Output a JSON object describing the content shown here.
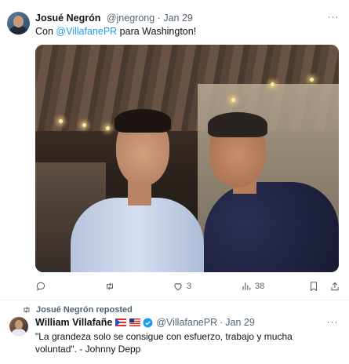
{
  "tweet1": {
    "author_name": "Josué Negrón",
    "author_handle": "@jnegrong",
    "separator": "·",
    "date": "Jan 29",
    "text_prefix": "Con ",
    "mention": "@VillafanePR",
    "text_suffix": " para Washington!",
    "actions": {
      "reply_count": "",
      "retweet_count": "",
      "like_count": "3",
      "views_count": "38"
    }
  },
  "tweet2": {
    "repost_label": "Josué Negrón reposted",
    "author_name": "William Villafañe",
    "author_handle": "@VillafanePR",
    "separator": "·",
    "date": "Jan 29",
    "text": "\"La grandeza solo se consigue con esfuerzo, trabajo y mucha voluntad\". - Johnny Depp"
  },
  "more_label": "···",
  "colors": {
    "accent": "#1d9bf0",
    "muted": "#536471"
  }
}
